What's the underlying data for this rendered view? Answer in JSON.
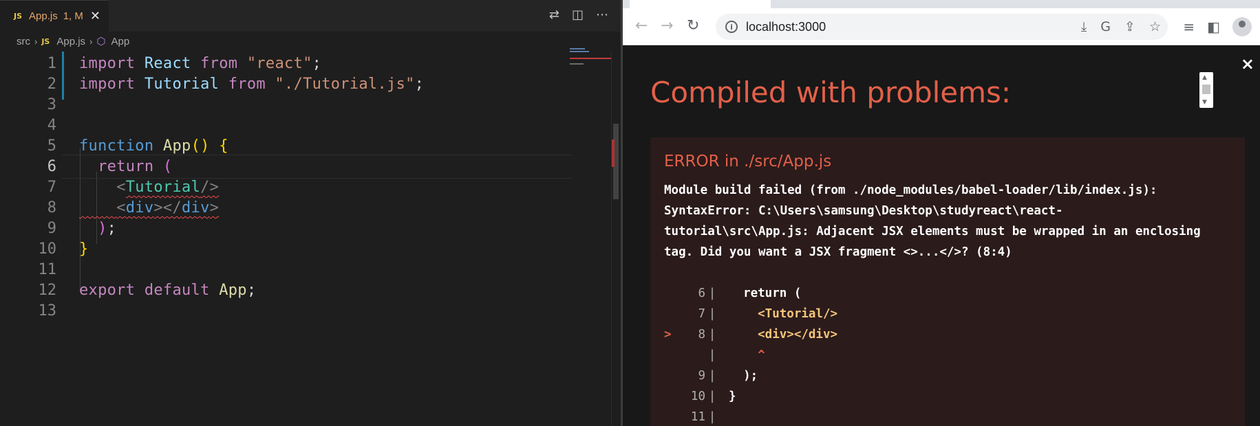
{
  "vscode": {
    "tab": {
      "badge": "JS",
      "title": "App.js",
      "status": "1, M",
      "close": "✕"
    },
    "actions": {
      "compare": "⇄",
      "split": "◫",
      "more": "⋯"
    },
    "breadcrumb": {
      "folder": "src",
      "badge": "JS",
      "file": "App.js",
      "symbol": "App"
    },
    "lines": [
      {
        "n": "1",
        "tokens": [
          [
            "kw",
            "import"
          ],
          [
            "",
            " "
          ],
          [
            "id",
            "React"
          ],
          [
            "",
            " "
          ],
          [
            "kw",
            "from"
          ],
          [
            "",
            " "
          ],
          [
            "str",
            "\"react\""
          ],
          [
            "",
            ";"
          ]
        ]
      },
      {
        "n": "2",
        "tokens": [
          [
            "kw",
            "import"
          ],
          [
            "",
            " "
          ],
          [
            "id",
            "Tutorial"
          ],
          [
            "",
            " "
          ],
          [
            "kw",
            "from"
          ],
          [
            "",
            " "
          ],
          [
            "str",
            "\"./Tutorial.js\""
          ],
          [
            "",
            ";"
          ]
        ]
      },
      {
        "n": "3",
        "tokens": []
      },
      {
        "n": "4",
        "tokens": []
      },
      {
        "n": "5",
        "tokens": [
          [
            "kw2",
            "function"
          ],
          [
            "",
            " "
          ],
          [
            "fn",
            "App"
          ],
          [
            "brace",
            "()"
          ],
          [
            "",
            " "
          ],
          [
            "brace",
            "{"
          ]
        ]
      },
      {
        "n": "6",
        "tokens": [
          [
            "",
            "  "
          ],
          [
            "kw",
            "return"
          ],
          [
            "",
            " "
          ],
          [
            "paren",
            "("
          ]
        ]
      },
      {
        "n": "7",
        "tokens": [
          [
            "",
            "    "
          ],
          [
            "br",
            "<"
          ],
          [
            "tag squig",
            "Tutorial"
          ],
          [
            "br squig",
            "/>"
          ]
        ]
      },
      {
        "n": "8",
        "tokens": [
          [
            "squig",
            "    "
          ],
          [
            "br squig",
            "<"
          ],
          [
            "tagb squig",
            "div"
          ],
          [
            "br squig",
            "></"
          ],
          [
            "tagb squig",
            "div"
          ],
          [
            "br squig",
            ">"
          ]
        ]
      },
      {
        "n": "9",
        "tokens": [
          [
            "",
            "  "
          ],
          [
            "paren",
            ")"
          ],
          [
            "",
            ";"
          ]
        ]
      },
      {
        "n": "10",
        "tokens": [
          [
            "brace",
            "}"
          ]
        ]
      },
      {
        "n": "11",
        "tokens": []
      },
      {
        "n": "12",
        "tokens": [
          [
            "kw",
            "export"
          ],
          [
            "",
            " "
          ],
          [
            "kw",
            "default"
          ],
          [
            "",
            " "
          ],
          [
            "fn",
            "App"
          ],
          [
            "",
            ";"
          ]
        ]
      },
      {
        "n": "13",
        "tokens": []
      }
    ],
    "active_line": "6"
  },
  "browser": {
    "url": "localhost:3000",
    "nav": {
      "back": "←",
      "forward": "→",
      "reload": "↻"
    },
    "omni_icons": {
      "install": "⤓",
      "translate": "G",
      "share": "⇪",
      "bookmark": "☆"
    },
    "toolbar_icons": {
      "reading_list": "≡",
      "side_panel": "◧"
    },
    "overlay": {
      "close": "×",
      "title": "Compiled with problems:",
      "error_heading": "ERROR in ./src/App.js",
      "error_message": "Module build failed (from ./node_modules/babel-loader/lib/index.js):\nSyntaxError: C:\\Users\\samsung\\Desktop\\studyreact\\react-\ntutorial\\src\\App.js: Adjacent JSX elements must be wrapped in an enclosing\ntag. Did you want a JSX fragment <>...</>? (8:4)",
      "frame": [
        {
          "mark": "",
          "num": "6",
          "code": "  return (",
          "style": ""
        },
        {
          "mark": "",
          "num": "7",
          "code": "    <Tutorial/>",
          "style": "tag"
        },
        {
          "mark": ">",
          "num": "8",
          "code": "    <div></div>",
          "style": "tag"
        },
        {
          "mark": "",
          "num": "",
          "code": "    ^",
          "style": "caret"
        },
        {
          "mark": "",
          "num": "9",
          "code": "  );",
          "style": ""
        },
        {
          "mark": "",
          "num": "10",
          "code": "}",
          "style": ""
        },
        {
          "mark": "",
          "num": "11",
          "code": "",
          "style": ""
        }
      ]
    }
  },
  "colors": {
    "error_red": "#e36049",
    "vscode_bg": "#1e1e1e",
    "overlay_bg": "#181818",
    "error_box_bg": "#2b1b1b"
  }
}
